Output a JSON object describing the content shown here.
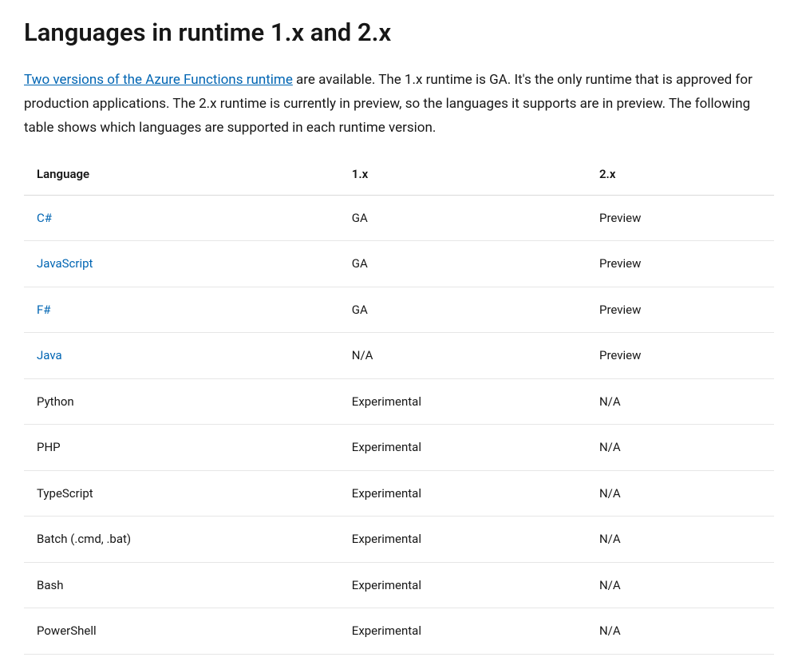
{
  "heading": "Languages in runtime 1.x and 2.x",
  "intro": {
    "link_text": "Two versions of the Azure Functions runtime",
    "rest_text": " are available. The 1.x runtime is GA. It's the only runtime that is approved for production applications. The 2.x runtime is currently in preview, so the languages it supports are in preview. The following table shows which languages are supported in each runtime version."
  },
  "table": {
    "headers": {
      "language": "Language",
      "v1": "1.x",
      "v2": "2.x"
    },
    "rows": [
      {
        "language": "C#",
        "is_link": true,
        "v1": "GA",
        "v2": "Preview"
      },
      {
        "language": "JavaScript",
        "is_link": true,
        "v1": "GA",
        "v2": "Preview"
      },
      {
        "language": "F#",
        "is_link": true,
        "v1": "GA",
        "v2": "Preview"
      },
      {
        "language": "Java",
        "is_link": true,
        "v1": "N/A",
        "v2": "Preview"
      },
      {
        "language": "Python",
        "is_link": false,
        "v1": "Experimental",
        "v2": "N/A"
      },
      {
        "language": "PHP",
        "is_link": false,
        "v1": "Experimental",
        "v2": "N/A"
      },
      {
        "language": "TypeScript",
        "is_link": false,
        "v1": "Experimental",
        "v2": "N/A"
      },
      {
        "language": "Batch (.cmd, .bat)",
        "is_link": false,
        "v1": "Experimental",
        "v2": "N/A"
      },
      {
        "language": "Bash",
        "is_link": false,
        "v1": "Experimental",
        "v2": "N/A"
      },
      {
        "language": "PowerShell",
        "is_link": false,
        "v1": "Experimental",
        "v2": "N/A"
      }
    ]
  }
}
